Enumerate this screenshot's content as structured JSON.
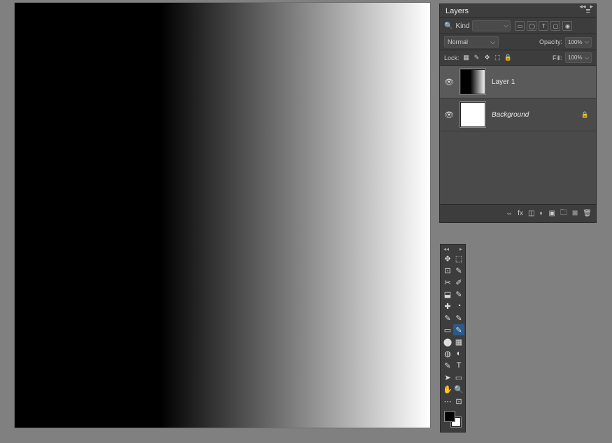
{
  "layersPanel": {
    "title": "Layers",
    "kindLabel": "Kind",
    "filterIcons": [
      "▭",
      "◯",
      "T",
      "▢",
      "◉"
    ],
    "blendMode": "Normal",
    "opacityLabel": "Opacity:",
    "opacityValue": "100%",
    "lockLabel": "Lock:",
    "lockIcons": [
      "▦",
      "✎",
      "✥",
      "⬚",
      "🔒"
    ],
    "fillLabel": "Fill:",
    "fillValue": "100%",
    "layers": [
      {
        "name": "Layer 1",
        "thumb": "grad",
        "selected": true,
        "locked": false,
        "italic": false
      },
      {
        "name": "Background",
        "thumb": "white",
        "selected": false,
        "locked": true,
        "italic": true
      }
    ],
    "footerIcons": [
      "⇔",
      "fx",
      "◫",
      "◐",
      "▣",
      "🗀",
      "⊞",
      "🗑"
    ]
  },
  "toolbox": {
    "tools": [
      "✥",
      "⬚",
      "⊡",
      "✎",
      "✂",
      "✐",
      "⬓",
      "✎",
      "✚",
      "◔",
      "✎",
      "✎",
      "▭",
      "✎",
      "⬤",
      "▦",
      "◍",
      "◐",
      "✎",
      "T",
      "➤",
      "▭",
      "✋",
      "🔍",
      "⋯",
      "⊡"
    ],
    "selectedIndex": 13,
    "fg": "#000000",
    "bg": "#ffffff"
  }
}
